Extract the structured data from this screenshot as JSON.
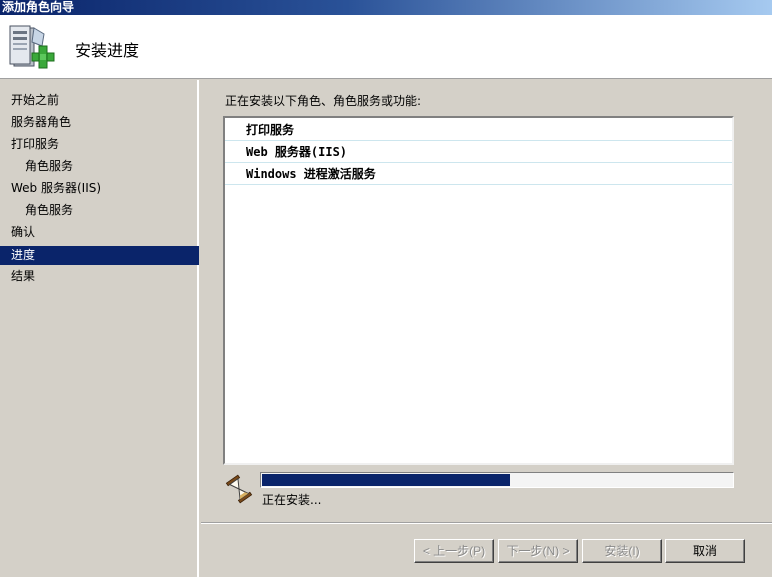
{
  "window": {
    "title": "添加角色向导"
  },
  "header": {
    "title": "安装进度",
    "icon": "server-add-icon"
  },
  "sidebar": {
    "items": [
      {
        "label": "开始之前"
      },
      {
        "label": "服务器角色"
      },
      {
        "label": "打印服务"
      },
      {
        "label": "角色服务"
      },
      {
        "label": "Web 服务器(IIS)"
      },
      {
        "label": "角色服务"
      },
      {
        "label": "确认"
      },
      {
        "label": "进度",
        "selected": true
      },
      {
        "label": "结果"
      }
    ]
  },
  "main": {
    "prompt": "正在安装以下角色、角色服务或功能:",
    "installing": [
      "打印服务",
      "Web 服务器(IIS)",
      "Windows 进程激活服务"
    ]
  },
  "status": {
    "icon": "hourglass-icon",
    "progress": 0.53,
    "text": "正在安装..."
  },
  "buttons": {
    "back": "< 上一步(P)",
    "next": "下一步(N) >",
    "install": "安装(I)",
    "cancel": "取消"
  },
  "colors": {
    "title_gradient_start": "#0a246a",
    "title_gradient_end": "#a6caf0",
    "selection": "#0a246a",
    "progress_fill": "#0a246a",
    "window_bg": "#d4d0c8"
  }
}
